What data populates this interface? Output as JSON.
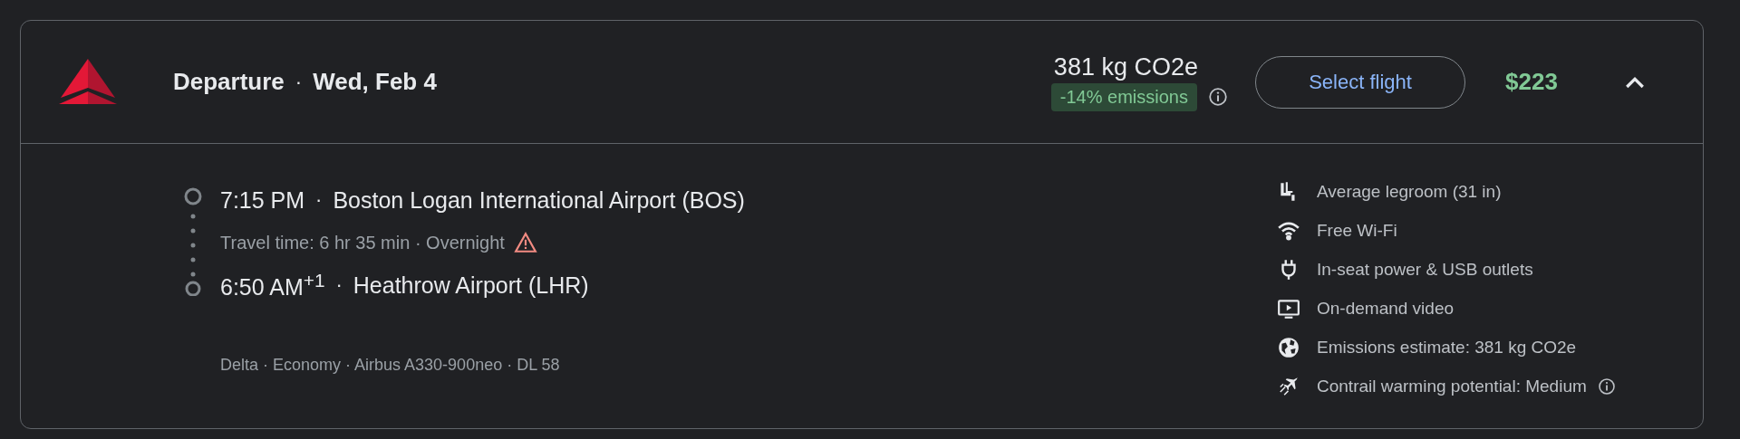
{
  "header": {
    "title": "Departure",
    "separator": "·",
    "date": "Wed, Feb 4",
    "emissions": "381 kg CO2e",
    "emissions_badge": "-14% emissions",
    "select_button": "Select flight",
    "price": "$223",
    "expanded": true
  },
  "segment": {
    "separator": "·",
    "departure_time": "7:15 PM",
    "departure_airport": "Boston Logan International Airport (BOS)",
    "travel_time": "Travel time: 6 hr 35 min · Overnight",
    "overnight_warning": true,
    "arrival_time": "6:50 AM$^{+1}$",
    "arrival_airport": "Heathrow Airport (LHR)",
    "details": "Delta · Economy · Airbus A330-900neo · DL 58"
  },
  "amenities": [
    {
      "kind": "legroom",
      "label": "Average legroom (31 in)",
      "info": false
    },
    {
      "kind": "wifi",
      "label": "Free Wi-Fi",
      "info": false
    },
    {
      "kind": "power",
      "label": "In-seat power & USB outlets",
      "info": false
    },
    {
      "kind": "video",
      "label": "On-demand video",
      "info": false
    },
    {
      "kind": "emissions",
      "label": "Emissions estimate: 381 kg CO2e",
      "info": false
    },
    {
      "kind": "contrail",
      "label": "Contrail warming potential: Medium",
      "info": true
    }
  ]
}
